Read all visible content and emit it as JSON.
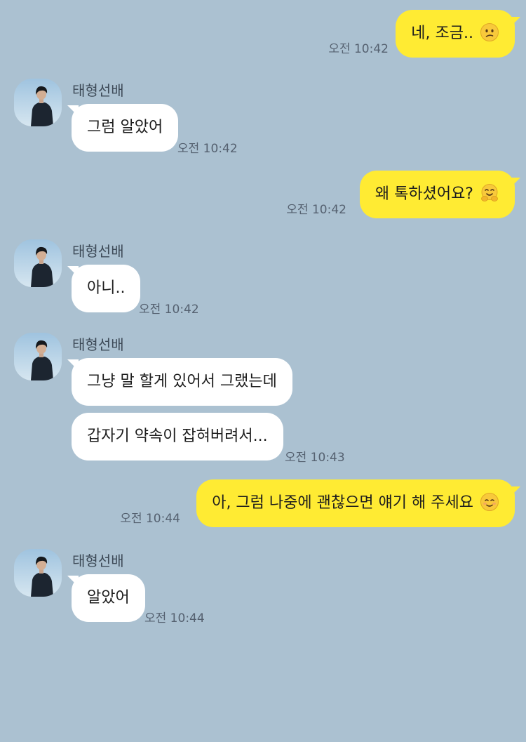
{
  "contact": {
    "name": "태형선배"
  },
  "messages": [
    {
      "text": "네, 조금..",
      "emoji": "confused-face",
      "time": "오전 10:42"
    },
    {
      "text": "그럼 알았어",
      "time": "오전 10:42"
    },
    {
      "text": "왜 톡하셨어요?",
      "emoji": "hugging-face",
      "time": "오전 10:42"
    },
    {
      "text": "아니..",
      "time": "오전 10:42"
    },
    {
      "text": "그냥 말 할게 있어서 그랬는데"
    },
    {
      "text": "갑자기 약속이 잡혀버려서...",
      "time": "오전 10:43"
    },
    {
      "text": "아, 그럼 나중에 괜찮으면 얘기 해 주세요",
      "emoji": "smiling-face",
      "time": "오전 10:44"
    },
    {
      "text": "알았어",
      "time": "오전 10:44"
    }
  ],
  "colors": {
    "background": "#abc1d1",
    "my_bubble": "#ffeb33",
    "their_bubble": "#ffffff"
  }
}
